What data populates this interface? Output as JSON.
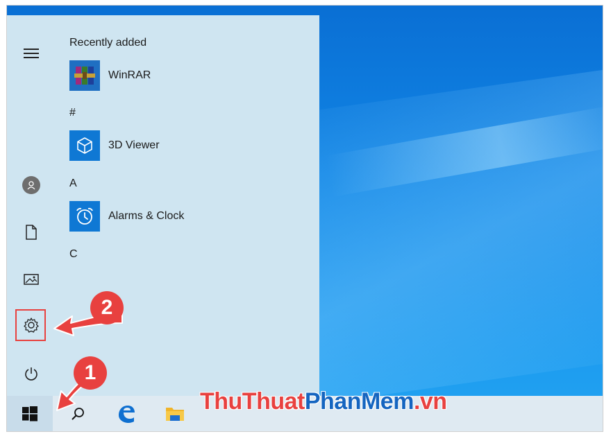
{
  "start_menu": {
    "sections": [
      {
        "header": "Recently added",
        "apps": [
          {
            "label": "WinRAR",
            "icon": "winrar-icon"
          }
        ]
      },
      {
        "header": "#",
        "apps": [
          {
            "label": "3D Viewer",
            "icon": "cube-icon"
          }
        ]
      },
      {
        "header": "A",
        "apps": [
          {
            "label": "Alarms & Clock",
            "icon": "alarm-clock-icon"
          }
        ]
      },
      {
        "header": "C",
        "apps": []
      }
    ],
    "rail_icons": [
      "hamburger-icon",
      "user-avatar-icon",
      "document-icon",
      "pictures-icon",
      "settings-gear-icon",
      "power-icon"
    ]
  },
  "taskbar": {
    "icons": [
      "windows-start-icon",
      "search-icon",
      "edge-icon",
      "file-explorer-icon"
    ]
  },
  "annotations": {
    "step1": "1",
    "step2": "2",
    "accent_color": "#e8413f"
  },
  "watermark": {
    "part1": "ThuThuat",
    "part2": "PhanMem",
    "part3": ".vn"
  },
  "colors": {
    "tile_blue": "#0f78d4",
    "menu_bg": "#cfe5f1",
    "desktop_blue": "#1186e6"
  }
}
